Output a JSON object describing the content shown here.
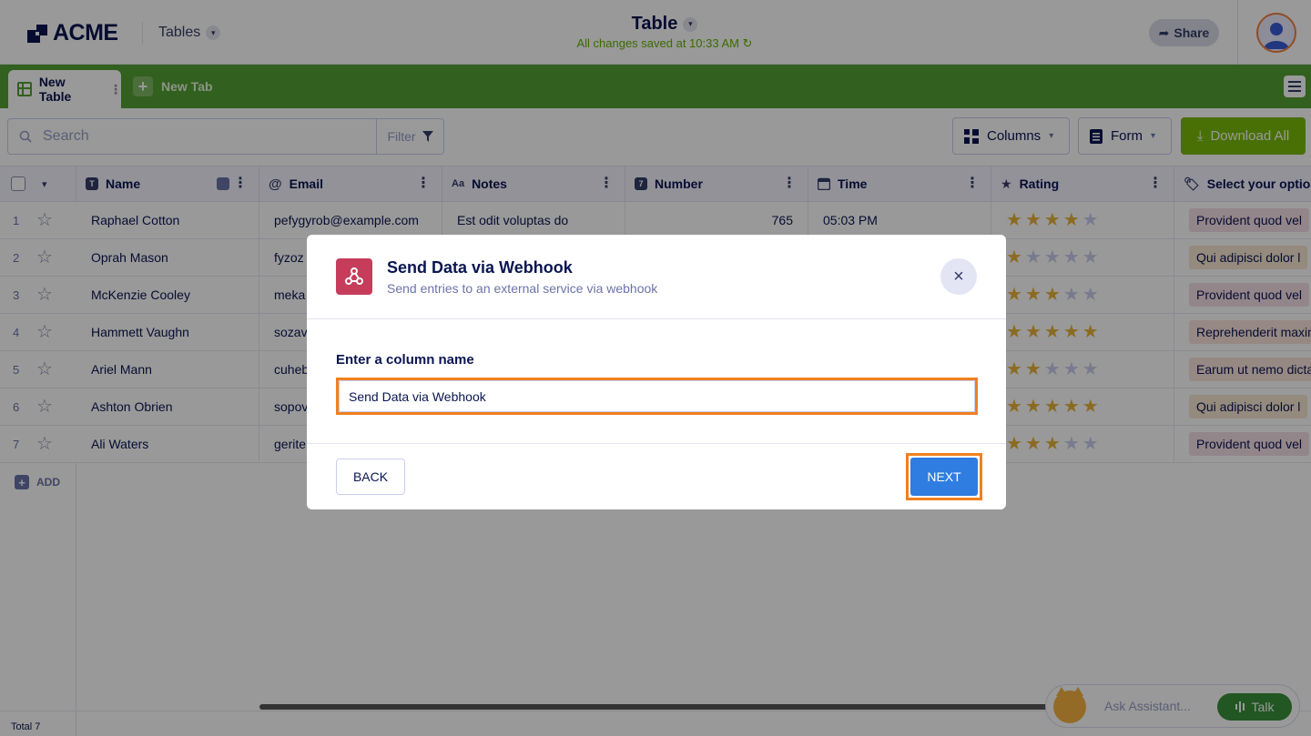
{
  "header": {
    "logo_text": "ACME",
    "tables_label": "Tables",
    "title": "Table",
    "saved_status": "All changes saved at 10:33 AM",
    "share_label": "Share"
  },
  "tabs": {
    "active_label": "New Table",
    "new_tab_label": "New Tab"
  },
  "toolbar": {
    "search_placeholder": "Search",
    "filter_label": "Filter",
    "columns_label": "Columns",
    "form_label": "Form",
    "download_label": "Download All"
  },
  "columns": [
    {
      "label": "Name",
      "icon": "T"
    },
    {
      "label": "Email",
      "icon": "@"
    },
    {
      "label": "Notes",
      "icon": "Aa"
    },
    {
      "label": "Number",
      "icon": "7"
    },
    {
      "label": "Time",
      "icon": "calendar"
    },
    {
      "label": "Rating",
      "icon": "star"
    },
    {
      "label": "Select your option",
      "icon": "tag"
    }
  ],
  "rows": [
    {
      "num": "1",
      "name": "Raphael Cotton",
      "email": "pefygyrob@example.com",
      "notes": "Est odit voluptas do",
      "number": "765",
      "time": "05:03 PM",
      "rating": 4,
      "option": "Provident quod vel",
      "option_color": "#f6dfe7"
    },
    {
      "num": "2",
      "name": "Oprah Mason",
      "email": "fyzoz",
      "notes": "",
      "number": "",
      "time": "",
      "rating": 1,
      "option": "Qui adipisci dolor l",
      "option_color": "#f7e6d2"
    },
    {
      "num": "3",
      "name": "McKenzie Cooley",
      "email": "meka",
      "notes": "",
      "number": "",
      "time": "",
      "rating": 3,
      "option": "Provident quod vel",
      "option_color": "#f6dfe7"
    },
    {
      "num": "4",
      "name": "Hammett Vaughn",
      "email": "sozav",
      "notes": "",
      "number": "",
      "time": "",
      "rating": 5,
      "option": "Reprehenderit maxim",
      "option_color": "#fbe4dc"
    },
    {
      "num": "5",
      "name": "Ariel Mann",
      "email": "cuheb",
      "notes": "",
      "number": "",
      "time": "",
      "rating": 2,
      "option": "Earum ut nemo dicta",
      "option_color": "#fbe4dc"
    },
    {
      "num": "6",
      "name": "Ashton Obrien",
      "email": "sopov",
      "notes": "",
      "number": "",
      "time": "",
      "rating": 5,
      "option": "Qui adipisci dolor l",
      "option_color": "#f7e6d2"
    },
    {
      "num": "7",
      "name": "Ali Waters",
      "email": "gerite",
      "notes": "",
      "number": "",
      "time": "",
      "rating": 3,
      "option": "Provident quod vel",
      "option_color": "#f6dfe7"
    }
  ],
  "add_label": "ADD",
  "footer": {
    "total_label": "Total 7"
  },
  "assistant": {
    "placeholder": "Ask Assistant...",
    "talk_label": "Talk"
  },
  "modal": {
    "title": "Send Data via Webhook",
    "subtitle": "Send entries to an external service via webhook",
    "field_label": "Enter a column name",
    "field_value": "Send Data via Webhook",
    "back_label": "BACK",
    "next_label": "NEXT"
  },
  "colors": {
    "brand_green": "#54a133",
    "download_green": "#78bb07",
    "primary_blue": "#2f7de1",
    "highlight_orange": "#f0801f",
    "webhook_red": "#c63d5b",
    "star_gold": "#e8b33b"
  }
}
